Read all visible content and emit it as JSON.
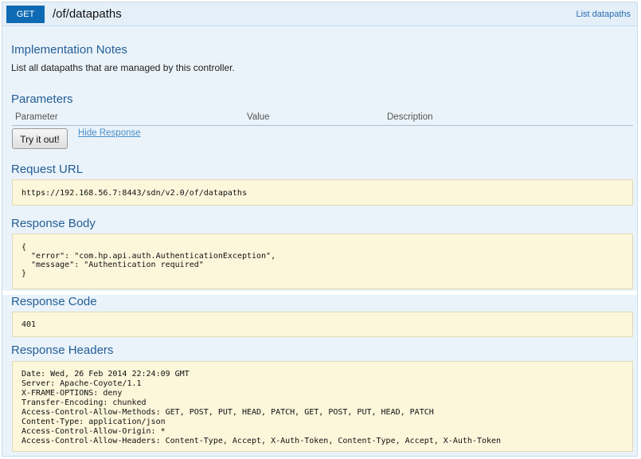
{
  "header": {
    "method": "GET",
    "path": "/of/datapaths",
    "list_link": "List datapaths"
  },
  "implementation": {
    "title": "Implementation Notes",
    "text": "List all datapaths that are managed by this controller."
  },
  "parameters": {
    "title": "Parameters",
    "columns": [
      "Parameter",
      "Value",
      "Description"
    ],
    "try_button": "Try it out!",
    "hide_response": "Hide Response"
  },
  "request_url": {
    "title": "Request URL",
    "value": "https://192.168.56.7:8443/sdn/v2.0/of/datapaths"
  },
  "response_body": {
    "title": "Response Body",
    "lines": [
      "{",
      "  \"error\": \"com.hp.api.auth.AuthenticationException\",",
      "  \"message\": \"Authentication required\"",
      "}"
    ]
  },
  "response_code": {
    "title": "Response Code",
    "value": "401"
  },
  "response_headers": {
    "title": "Response Headers",
    "lines": [
      "Date: Wed, 26 Feb 2014 22:24:09 GMT",
      "Server: Apache-Coyote/1.1",
      "X-FRAME-OPTIONS: deny",
      "Transfer-Encoding: chunked",
      "Access-Control-Allow-Methods: GET, POST, PUT, HEAD, PATCH, GET, POST, PUT, HEAD, PATCH",
      "Content-Type: application/json",
      "Access-Control-Allow-Origin: *",
      "Access-Control-Allow-Headers: Content-Type, Accept, X-Auth-Token, Content-Type, Accept, X-Auth-Token"
    ]
  },
  "colors": {
    "method_badge": "#0f6ab4",
    "section_title": "#245e96",
    "panel_bg": "#eaf3fa",
    "code_box_bg": "#fcf6db"
  }
}
